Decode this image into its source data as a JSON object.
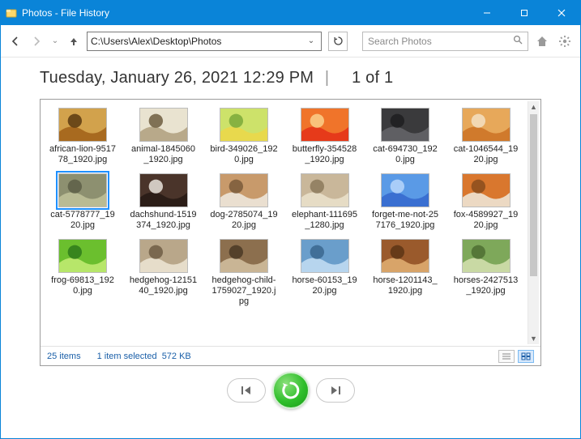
{
  "window": {
    "title": "Photos - File History"
  },
  "toolbar": {
    "path": "C:\\Users\\Alex\\Desktop\\Photos",
    "search_placeholder": "Search Photos"
  },
  "header": {
    "timestamp": "Tuesday, January 26, 2021 12:29 PM",
    "page_indicator": "1 of 1"
  },
  "items": [
    {
      "name": "african-lion-951778_1920.jpg",
      "palette": [
        "#d2a24c",
        "#a86a1f",
        "#5a3a10"
      ],
      "selected": false
    },
    {
      "name": "animal-1845060_1920.jpg",
      "palette": [
        "#e9e3d0",
        "#b8a98a",
        "#6d5d3f"
      ],
      "selected": false
    },
    {
      "name": "bird-349026_1920.jpg",
      "palette": [
        "#cde26a",
        "#e8d94d",
        "#7aa93a"
      ],
      "selected": false
    },
    {
      "name": "butterfly-354528_1920.jpg",
      "palette": [
        "#f0742a",
        "#e63a1a",
        "#fad089"
      ],
      "selected": false
    },
    {
      "name": "cat-694730_1920.jpg",
      "palette": [
        "#3a3a3c",
        "#5f5f63",
        "#1e1e20"
      ],
      "selected": false
    },
    {
      "name": "cat-1046544_1920.jpg",
      "palette": [
        "#e7a85a",
        "#d07a2c",
        "#f3e0c3"
      ],
      "selected": false
    },
    {
      "name": "cat-5778777_1920.jpg",
      "palette": [
        "#8d9070",
        "#b9bb94",
        "#5d5f46"
      ],
      "selected": true
    },
    {
      "name": "dachshund-1519374_1920.jpg",
      "palette": [
        "#4a342a",
        "#2b1d17",
        "#e8e3da"
      ],
      "selected": false
    },
    {
      "name": "dog-2785074_1920.jpg",
      "palette": [
        "#c89a6b",
        "#eadfd0",
        "#7a5a3a"
      ],
      "selected": false
    },
    {
      "name": "elephant-111695_1280.jpg",
      "palette": [
        "#c9b79a",
        "#e6dcc5",
        "#8c7a5c"
      ],
      "selected": false
    },
    {
      "name": "forget-me-not-257176_1920.jpg",
      "palette": [
        "#5a9ae6",
        "#3a6fd1",
        "#b7d6fa"
      ],
      "selected": false
    },
    {
      "name": "fox-4589927_1920.jpg",
      "palette": [
        "#d9772e",
        "#ecd9c3",
        "#8a4c1c"
      ],
      "selected": false
    },
    {
      "name": "frog-69813_1920.jpg",
      "palette": [
        "#6bbf2e",
        "#b7e66a",
        "#2e7a1a"
      ],
      "selected": false
    },
    {
      "name": "hedgehog-1215140_1920.jpg",
      "palette": [
        "#b9a78a",
        "#e6ddca",
        "#6e5d44"
      ],
      "selected": false
    },
    {
      "name": "hedgehog-child-1759027_1920.jpg",
      "palette": [
        "#8c6f4e",
        "#c9b595",
        "#4a3a26"
      ],
      "selected": false
    },
    {
      "name": "horse-60153_1920.jpg",
      "palette": [
        "#6a9ecb",
        "#b7d5ee",
        "#3a668f"
      ],
      "selected": false
    },
    {
      "name": "horse-1201143_1920.jpg",
      "palette": [
        "#9a5a2c",
        "#d8a469",
        "#5d3515"
      ],
      "selected": false
    },
    {
      "name": "horses-2427513_1920.jpg",
      "palette": [
        "#7ea85a",
        "#c9d9a4",
        "#4e6e32"
      ],
      "selected": false
    }
  ],
  "status": {
    "count_label": "25 items",
    "selection_label": "1 item selected",
    "selection_size": "572 KB"
  }
}
